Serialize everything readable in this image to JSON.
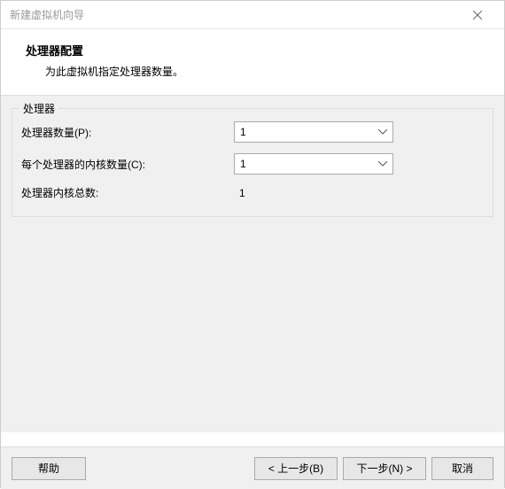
{
  "window": {
    "title": "新建虚拟机向导"
  },
  "header": {
    "title": "处理器配置",
    "subtitle": "为此虚拟机指定处理器数量。"
  },
  "group": {
    "legend": "处理器",
    "rows": {
      "processors": {
        "label": "处理器数量(P):",
        "value": "1"
      },
      "cores": {
        "label": "每个处理器的内核数量(C):",
        "value": "1"
      },
      "total": {
        "label": "处理器内核总数:",
        "value": "1"
      }
    }
  },
  "buttons": {
    "help": "帮助",
    "back": "< 上一步(B)",
    "next": "下一步(N) >",
    "cancel": "取消"
  }
}
